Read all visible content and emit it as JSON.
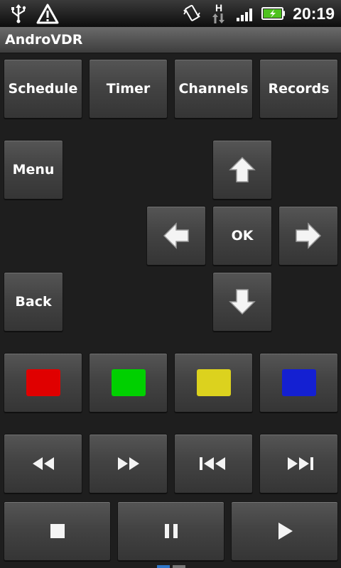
{
  "status_bar": {
    "time": "20:19",
    "network_letter": "H",
    "icons": [
      "usb-icon",
      "warning-icon",
      "vibrate-icon",
      "data-arrows-icon",
      "signal-icon",
      "battery-charging-icon"
    ]
  },
  "app": {
    "title": "AndroVDR"
  },
  "nav_buttons": {
    "schedule": "Schedule",
    "timer": "Timer",
    "channels": "Channels",
    "records": "Records"
  },
  "remote": {
    "menu": "Menu",
    "back": "Back",
    "ok": "OK",
    "up_icon": "arrow-up-icon",
    "down_icon": "arrow-down-icon",
    "left_icon": "arrow-left-icon",
    "right_icon": "arrow-right-icon"
  },
  "color_keys": {
    "red": "#e00000",
    "green": "#00d000",
    "yellow": "#dcd21e",
    "blue": "#1420d2"
  },
  "playback": {
    "icons": [
      "rewind-icon",
      "fast-forward-icon",
      "skip-previous-icon",
      "skip-next-icon",
      "stop-icon",
      "pause-icon",
      "play-icon"
    ]
  }
}
